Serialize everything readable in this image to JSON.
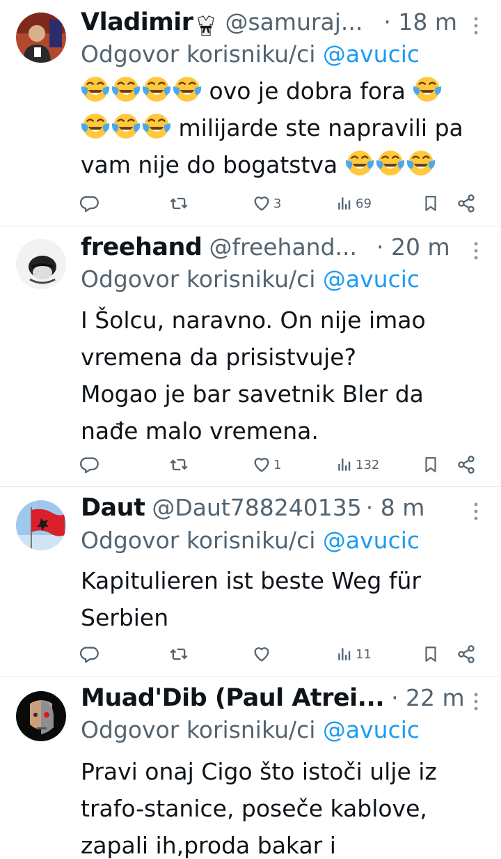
{
  "tweets": [
    {
      "name": "Vladimir",
      "handle": "@samuraj...",
      "time": "· 18 m",
      "reply_prefix": "Odgovor korisniku/ci",
      "mention": "@avucic",
      "line1": "ovo je dobra fora",
      "line2": "milijarde ste napravili pa",
      "line3": "vam nije do bogatstva",
      "likes": "3",
      "views": "69"
    },
    {
      "name": "freehand",
      "handle": "@freehand...",
      "time": "· 20 m",
      "reply_prefix": "Odgovor korisniku/ci",
      "mention": "@avucic",
      "line1": "I Šolcu, naravno. On nije imao",
      "line2": "vremena da prisistvuje?",
      "line3": "Mogao je bar savetnik Bler da",
      "line4": "nađe malo vremena.",
      "likes": "1",
      "views": "132"
    },
    {
      "name": "Daut",
      "handle": "@Daut788240135",
      "time": "· 8 m",
      "reply_prefix": "Odgovor korisniku/ci",
      "mention": "@avucic",
      "line1": "Kapitulieren ist beste Weg für",
      "line2": "Serbien",
      "likes": "",
      "views": "11"
    },
    {
      "name": "Muad'Dib (Paul Atrei...",
      "handle": "",
      "time": "· 22 m",
      "reply_prefix": "Odgovor korisniku/ci",
      "mention": "@avucic",
      "line1": "Pravi onaj Cigo što istoči ulje iz",
      "line2": "trafo-stanice, poseče kablove,",
      "line3": "zapali ih,proda bakar i"
    }
  ],
  "icons": {
    "reply": "reply-icon",
    "retweet": "retweet-icon",
    "like": "heart-icon",
    "views": "views-icon",
    "bookmark": "bookmark-icon",
    "share": "share-icon",
    "more": "more-icon",
    "emoji": "laughing-crying-emoji"
  },
  "colors": {
    "link": "#1d9bf0",
    "muted": "#536471",
    "text": "#0f1419",
    "divider": "#e6ecf0"
  }
}
